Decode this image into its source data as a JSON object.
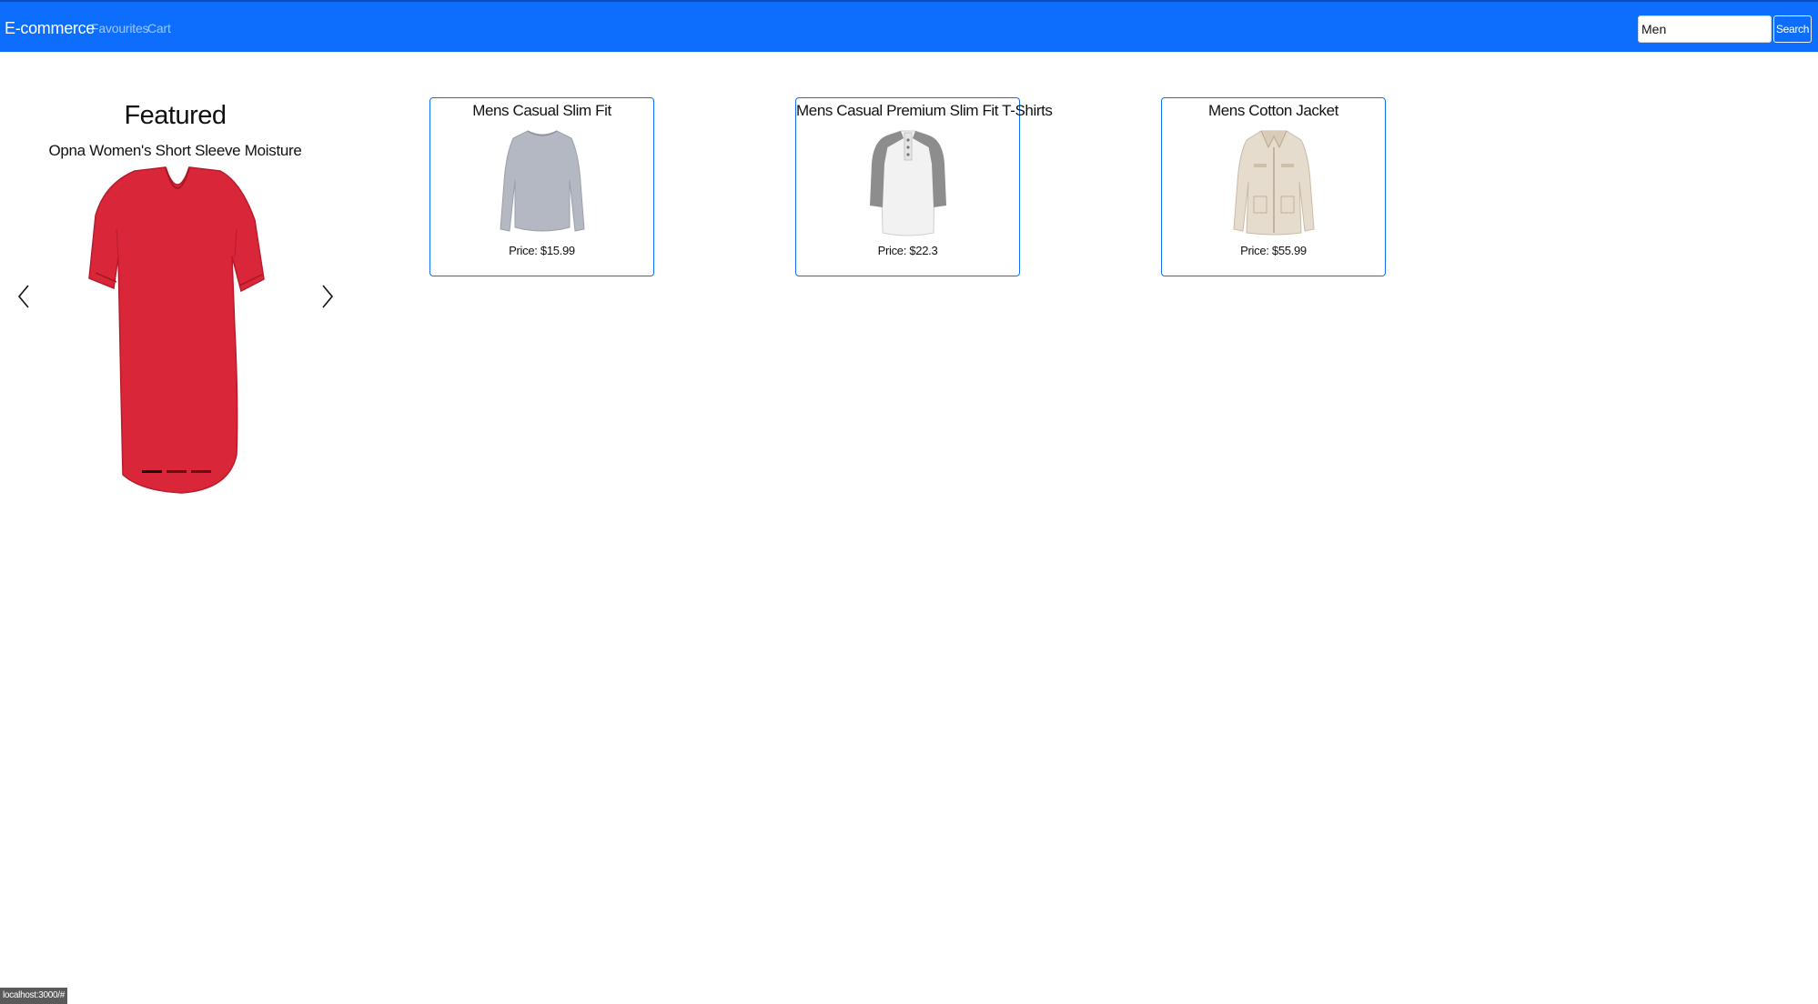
{
  "navbar": {
    "brand": "E-commerce",
    "links": [
      "Favourites",
      "Cart"
    ],
    "search_value": "Men",
    "search_button": "Search",
    "accent_color": "#0d6efd"
  },
  "featured": {
    "title": "Featured",
    "item_name": "Opna Women's Short Sleeve Moisture",
    "slide_count": 3,
    "active_slide": 1
  },
  "products": [
    {
      "name": "Mens Casual Slim Fit",
      "price": "Price: $15.99",
      "image": "long-sleeve-shirt-icon"
    },
    {
      "name": "Mens Casual Premium Slim Fit T-Shirts",
      "price": "Price: $22.3",
      "image": "raglan-tshirt-icon"
    },
    {
      "name": "Mens Cotton Jacket",
      "price": "Price: $55.99",
      "image": "jacket-icon"
    }
  ],
  "status_url": "localhost:3000/#"
}
